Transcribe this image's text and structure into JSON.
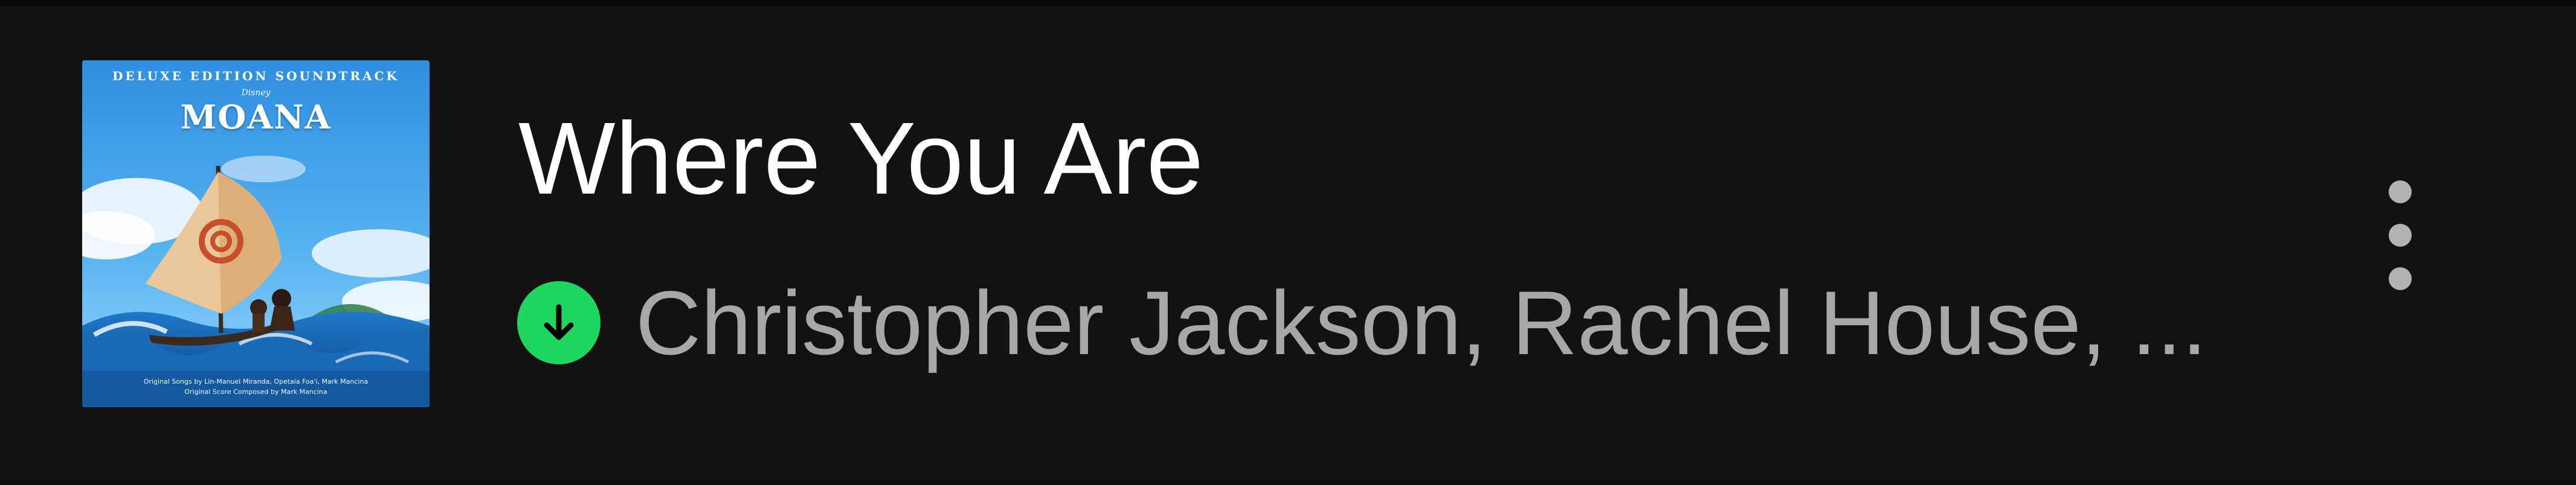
{
  "track": {
    "title": "Where You Are",
    "artists": "Christopher Jackson, Rachel House, ..."
  },
  "album_cover": {
    "edition_text": "DELUXE EDITION SOUNDTRACK",
    "brand_text": "Disney",
    "title_text": "MOANA",
    "credits_line_1": "Original Songs by Lin-Manuel Miranda, Opetaia Foa'i, Mark Mancina",
    "credits_line_2": "Original Score Composed by Mark Mancina"
  },
  "status": {
    "downloaded_icon": "download-arrow-icon",
    "downloaded_color": "#1ed760"
  },
  "actions": {
    "more_icon": "more-vertical-icon"
  },
  "colors": {
    "background": "#121212",
    "title": "#ffffff",
    "subtitle": "#a7a7a7",
    "accent": "#1ed760"
  }
}
